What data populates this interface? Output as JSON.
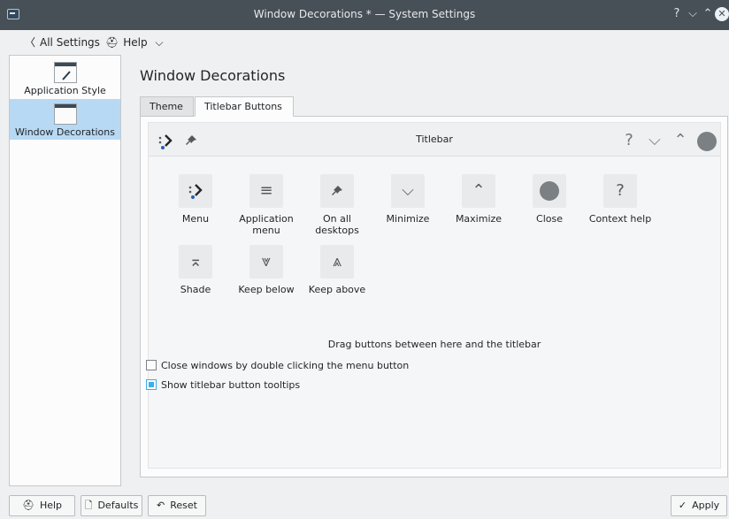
{
  "window": {
    "title": "Window Decorations * — System Settings"
  },
  "toolbar": {
    "back_label": "All Settings",
    "help_label": "Help"
  },
  "sidebar": {
    "items": [
      {
        "label": "Application Style"
      },
      {
        "label": "Window Decorations"
      }
    ]
  },
  "page": {
    "title": "Window Decorations"
  },
  "tabs": [
    {
      "label": "Theme"
    },
    {
      "label": "Titlebar Buttons"
    }
  ],
  "preview": {
    "title": "Titlebar",
    "hint": "Drag buttons between here and the titlebar"
  },
  "buttons": [
    {
      "label": "Menu"
    },
    {
      "label": "Application menu"
    },
    {
      "label": "On all desktops"
    },
    {
      "label": "Minimize"
    },
    {
      "label": "Maximize"
    },
    {
      "label": "Close"
    },
    {
      "label": "Context help"
    },
    {
      "label": "Shade"
    },
    {
      "label": "Keep below"
    },
    {
      "label": "Keep above"
    }
  ],
  "options": [
    {
      "label": "Close windows by double clicking the menu button",
      "checked": false
    },
    {
      "label": "Show titlebar button tooltips",
      "checked": true
    }
  ],
  "footer": {
    "help": "Help",
    "defaults": "Defaults",
    "reset": "Reset",
    "apply": "Apply"
  },
  "colors": {
    "accent": "#3daee9",
    "selection": "#b7d9f4",
    "titlebar": "#475057"
  }
}
